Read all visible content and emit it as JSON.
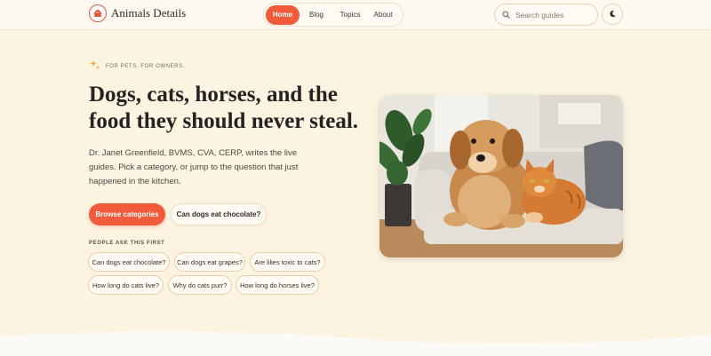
{
  "header": {
    "brand": "Animals Details",
    "nav": [
      {
        "label": "Home",
        "active": true
      },
      {
        "label": "Blog",
        "active": false
      },
      {
        "label": "Topics",
        "active": false
      },
      {
        "label": "About",
        "active": false
      }
    ],
    "search": {
      "placeholder": "Search guides",
      "icon": "search-icon"
    },
    "theme_toggle": {
      "icon": "moon-icon"
    }
  },
  "hero": {
    "eyebrow": "FOR PETS. FOR OWNERS.",
    "eyebrow_icon": "sparkle-icon",
    "title": "Dogs, cats, horses, and the food they should never steal.",
    "lead": "Dr. Janet Greenfield, BVMS, CVA, CERP, writes the live guides. Pick a category, or jump to the question that just happened in the kitchen.",
    "primary_cta": "Browse categories",
    "secondary_cta": "Can dogs eat chocolate?",
    "image": "golden-retriever-and-orange-cat-on-sofa"
  },
  "questions": {
    "label": "PEOPLE ASK THIS FIRST",
    "items": [
      "Can dogs eat chocolate?",
      "Can dogs eat grapes?",
      "Are lilies toxic to cats?",
      "How long do cats live?",
      "Why do cats purr?",
      "How long do horses live?"
    ]
  },
  "colors": {
    "accent": "#ef5b3b",
    "background": "#fdf3e1",
    "header": "#fdf8f0",
    "chip_border": "#e6cfa8"
  }
}
